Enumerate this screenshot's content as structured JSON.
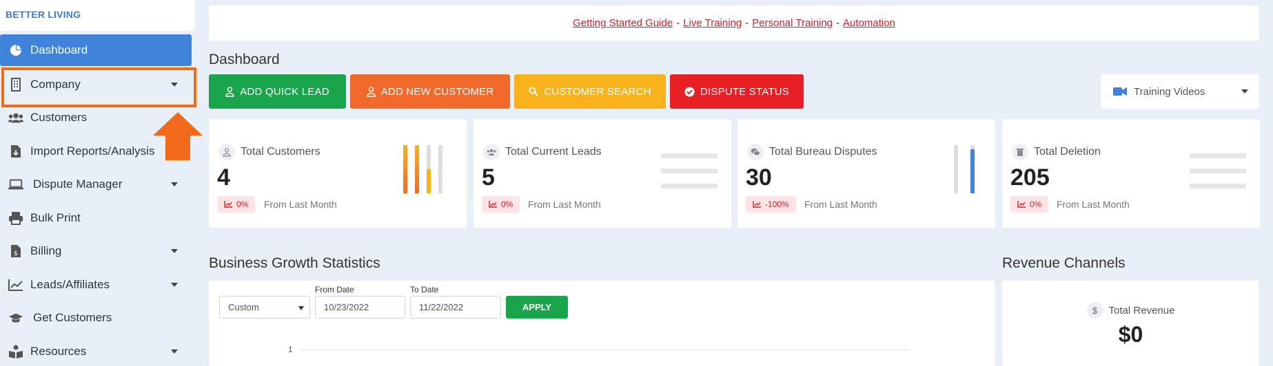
{
  "brand": "BETTER LIVING",
  "sidebar": {
    "items": [
      {
        "label": "Dashboard",
        "icon": "chart-pie-icon"
      },
      {
        "label": "Company",
        "icon": "building-icon"
      },
      {
        "label": "Customers",
        "icon": "users-icon"
      },
      {
        "label": "Import Reports/Analysis",
        "icon": "file-import-icon"
      },
      {
        "label": "Dispute Manager",
        "icon": "laptop-icon"
      },
      {
        "label": "Bulk Print",
        "icon": "printer-icon"
      },
      {
        "label": "Billing",
        "icon": "invoice-icon"
      },
      {
        "label": "Leads/Affiliates",
        "icon": "chart-line-icon"
      },
      {
        "label": "Get Customers",
        "icon": "graduation-cap-icon"
      },
      {
        "label": "Resources",
        "icon": "book-reader-icon"
      }
    ]
  },
  "links": {
    "getting_started": "Getting Started Guide",
    "live_training": "Live Training",
    "personal_training": "Personal Training",
    "automation": "Automation",
    "separator": "-"
  },
  "page_title": "Dashboard",
  "actions": {
    "quick_lead": "ADD QUICK LEAD",
    "new_customer": "ADD NEW CUSTOMER",
    "customer_search": "CUSTOMER SEARCH",
    "dispute_status": "DISPUTE STATUS"
  },
  "training_select": "Training Videos",
  "stats": [
    {
      "label": "Total Customers",
      "value": "4",
      "change": "0%",
      "from": "From Last Month"
    },
    {
      "label": "Total Current Leads",
      "value": "5",
      "change": "0%",
      "from": "From Last Month"
    },
    {
      "label": "Total Bureau Disputes",
      "value": "30",
      "change": "-100%",
      "from": "From Last Month"
    },
    {
      "label": "Total Deletion",
      "value": "205",
      "change": "0%",
      "from": "From Last Month"
    }
  ],
  "growth": {
    "title": "Business Growth Statistics",
    "range_select": "Custom",
    "from_label": "From Date",
    "from_value": "10/23/2022",
    "to_label": "To Date",
    "to_value": "11/22/2022",
    "apply": "APPLY",
    "y_tick": "1"
  },
  "revenue": {
    "title": "Revenue Channels",
    "label": "Total Revenue",
    "value": "$0"
  },
  "colors": {
    "primary": "#3f83db",
    "green": "#1aa44c",
    "orange": "#f16a2c",
    "yellow": "#f8b21c",
    "red": "#e82026",
    "highlight": "#f16a1c"
  }
}
